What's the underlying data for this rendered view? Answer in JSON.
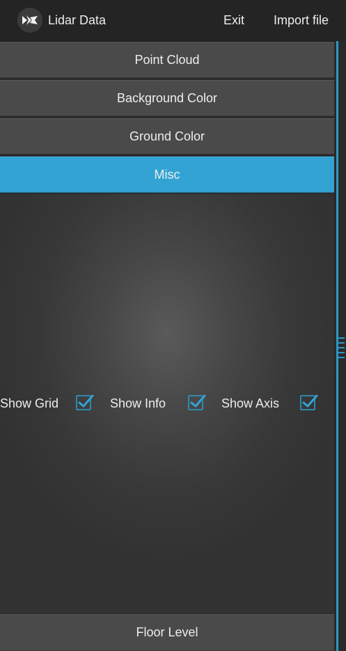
{
  "app": {
    "title": "Lidar Data",
    "menu": {
      "exit": "Exit",
      "import": "Import file"
    }
  },
  "accordion": {
    "items": [
      {
        "label": "Point Cloud",
        "active": false
      },
      {
        "label": "Background Color",
        "active": false
      },
      {
        "label": "Ground Color",
        "active": false
      },
      {
        "label": "Misc",
        "active": true
      }
    ],
    "footer_item": {
      "label": "Floor Level"
    }
  },
  "misc": {
    "options": [
      {
        "label": "Show Grid",
        "checked": true
      },
      {
        "label": "Show Info",
        "checked": true
      },
      {
        "label": "Show Axis",
        "checked": true
      }
    ]
  },
  "colors": {
    "accent": "#33a3d4",
    "button_bg": "#4a4a4a",
    "appbar_bg": "#242424"
  }
}
